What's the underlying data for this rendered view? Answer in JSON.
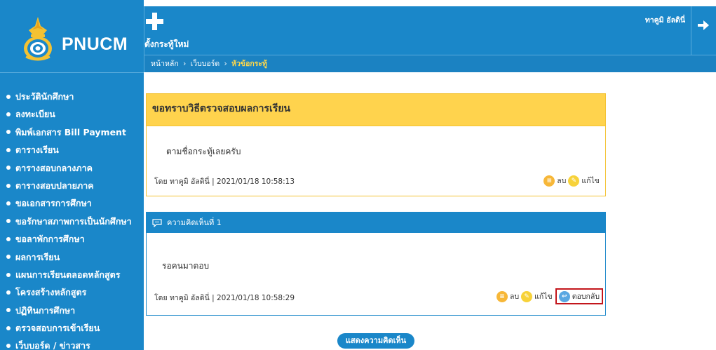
{
  "brand": {
    "name": "PNUCM"
  },
  "colors": {
    "primary": "#1a87c9",
    "post_header": "#ffd34d",
    "highlight": "#c3161c",
    "breadcrumb_current": "#ffd84a"
  },
  "header": {
    "new_topic_label": "ตั้งกระทู้ใหม่",
    "user_name": "ทาคูมิ อัลดินี่",
    "breadcrumb": [
      {
        "label": "หน้าหลัก"
      },
      {
        "label": "เว็บบอร์ด"
      },
      {
        "label": "หัวข้อกระทู้"
      }
    ],
    "breadcrumb_separator": "›"
  },
  "sidebar": {
    "items": [
      {
        "label": "ประวัตินักศึกษา"
      },
      {
        "label": "ลงทะเบียน"
      },
      {
        "label": "พิมพ์เอกสาร Bill Payment"
      },
      {
        "label": "ตารางเรียน"
      },
      {
        "label": "ตารางสอบกลางภาค"
      },
      {
        "label": "ตารางสอบปลายภาค"
      },
      {
        "label": "ขอเอกสารการศึกษา"
      },
      {
        "label": "ขอรักษาสภาพการเป็นนักศึกษา"
      },
      {
        "label": "ขอลาพักการศึกษา"
      },
      {
        "label": "ผลการเรียน"
      },
      {
        "label": "แผนการเรียนตลอดหลักสูตร"
      },
      {
        "label": "โครงสร้างหลักสูตร"
      },
      {
        "label": "ปฏิทินการศึกษา"
      },
      {
        "label": "ตรวจสอบการเข้าเรียน"
      },
      {
        "label": "เว็บบอร์ด / ข่าวสาร"
      }
    ]
  },
  "post": {
    "title": "ขอทราบวิธีตรวจสอบผลการเรียน",
    "body": "ตามชื่อกระทู้เลยครับ",
    "meta": "โดย ทาคูมิ อัลดินี่ | 2021/01/18 10:58:13",
    "delete_label": "ลบ",
    "edit_label": "แก้ไข"
  },
  "comment": {
    "header": "ความคิดเห็นที่ 1",
    "body": "รอคนมาตอบ",
    "meta": "โดย ทาคูมิ อัลดินี่ | 2021/01/18 10:58:29",
    "delete_label": "ลบ",
    "edit_label": "แก้ไข",
    "reply_label": "ตอบกลับ"
  },
  "show_comments_label": "แสดงความคิดเห็น",
  "icons": {
    "emblem": "university-emblem-icon",
    "new_topic": "plus-icon",
    "logout": "arrow-right-icon",
    "comment": "speech-bubble-icon",
    "delete": "trash-icon",
    "edit": "pencil-icon",
    "reply": "reply-arrow-icon"
  }
}
